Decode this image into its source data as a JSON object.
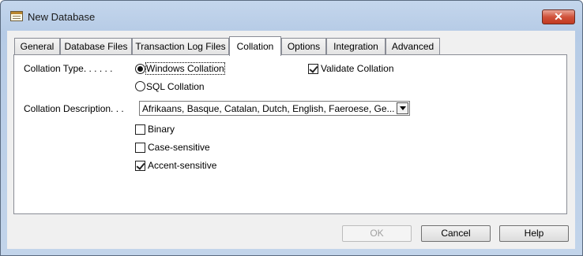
{
  "window": {
    "title": "New Database",
    "icon": "database-icon",
    "close_label": "✕"
  },
  "tabs": [
    {
      "label": "General"
    },
    {
      "label": "Database Files"
    },
    {
      "label": "Transaction Log Files"
    },
    {
      "label": "Collation",
      "active": true
    },
    {
      "label": "Options"
    },
    {
      "label": "Integration"
    },
    {
      "label": "Advanced"
    }
  ],
  "collation": {
    "type_label": "Collation Type. . . . . .",
    "windows_option": "Windows Collation",
    "windows_selected": true,
    "sql_option": "SQL Collation",
    "sql_selected": false,
    "validate_label": "Validate Collation",
    "validate_checked": true,
    "description_label": "Collation Description. . .",
    "description_value": "Afrikaans, Basque, Catalan, Dutch, English, Faeroese, Ge...",
    "binary_label": "Binary",
    "binary_checked": false,
    "case_label": "Case-sensitive",
    "case_checked": false,
    "accent_label": "Accent-sensitive",
    "accent_checked": true
  },
  "buttons": {
    "ok": "OK",
    "cancel": "Cancel",
    "help": "Help"
  }
}
